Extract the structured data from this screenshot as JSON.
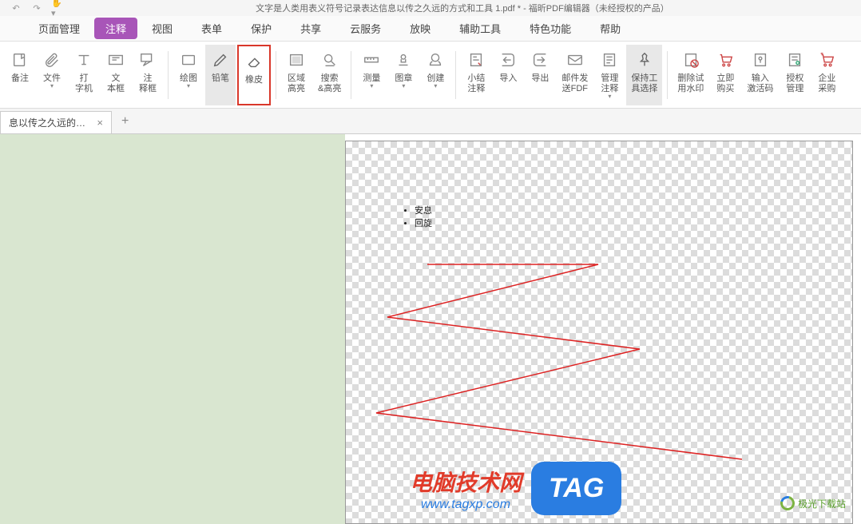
{
  "title": "文字是人类用表义符号记录表达信息以传之久远的方式和工具 1.pdf * - 福昕PDF编辑器（未经授权的产品）",
  "menu": {
    "items": [
      "页面管理",
      "注释",
      "视图",
      "表单",
      "保护",
      "共享",
      "云服务",
      "放映",
      "辅助工具",
      "特色功能",
      "帮助"
    ],
    "activeIndex": 1
  },
  "ribbon": [
    {
      "label": "备注",
      "icon": "note",
      "dropdown": false
    },
    {
      "label": "文件",
      "icon": "attach",
      "dropdown": true
    },
    {
      "label": "打\n字机",
      "icon": "typewriter",
      "dropdown": false
    },
    {
      "label": "文\n本框",
      "icon": "textbox",
      "dropdown": false
    },
    {
      "label": "注\n释框",
      "icon": "callout",
      "dropdown": false
    },
    {
      "label": "绘图",
      "icon": "shape",
      "dropdown": true,
      "sep": true
    },
    {
      "label": "铅笔",
      "icon": "pencil",
      "dropdown": false,
      "active": true
    },
    {
      "label": "橡皮",
      "icon": "eraser",
      "dropdown": false,
      "highlighted": true
    },
    {
      "label": "区域\n高亮",
      "icon": "area-highlight",
      "dropdown": false,
      "sep": true
    },
    {
      "label": "搜索\n&高亮",
      "icon": "search-highlight",
      "dropdown": false
    },
    {
      "label": "测量",
      "icon": "ruler",
      "dropdown": true,
      "sep": true
    },
    {
      "label": "图章",
      "icon": "stamp",
      "dropdown": true
    },
    {
      "label": "创建",
      "icon": "create",
      "dropdown": true
    },
    {
      "label": "小结\n注释",
      "icon": "summary",
      "dropdown": false,
      "sep": true
    },
    {
      "label": "导入",
      "icon": "import",
      "dropdown": false
    },
    {
      "label": "导出",
      "icon": "export",
      "dropdown": false
    },
    {
      "label": "邮件发\n送FDF",
      "icon": "mail",
      "dropdown": false
    },
    {
      "label": "管理\n注释",
      "icon": "manage",
      "dropdown": true
    },
    {
      "label": "保持工\n具选择",
      "icon": "pin",
      "dropdown": false,
      "pinned": true
    },
    {
      "label": "删除试\n用水印",
      "icon": "remove-wm",
      "dropdown": false,
      "sep": true
    },
    {
      "label": "立即\n购买",
      "icon": "cart",
      "dropdown": false
    },
    {
      "label": "输入\n激活码",
      "icon": "key",
      "dropdown": false
    },
    {
      "label": "授权\n管理",
      "icon": "license",
      "dropdown": false
    },
    {
      "label": "企业\n采购",
      "icon": "enterprise",
      "dropdown": false
    }
  ],
  "tab": {
    "label": "息以传之久远的方...",
    "add": "+"
  },
  "document": {
    "bullets": [
      "安息",
      "回旋"
    ]
  },
  "watermark": {
    "title": "电脑技术网",
    "url": "www.tagxp.com",
    "tag": "TAG",
    "logo": "极光下载站"
  },
  "icons": {
    "undo": "↶",
    "redo": "↷",
    "hand": "✋▾"
  }
}
